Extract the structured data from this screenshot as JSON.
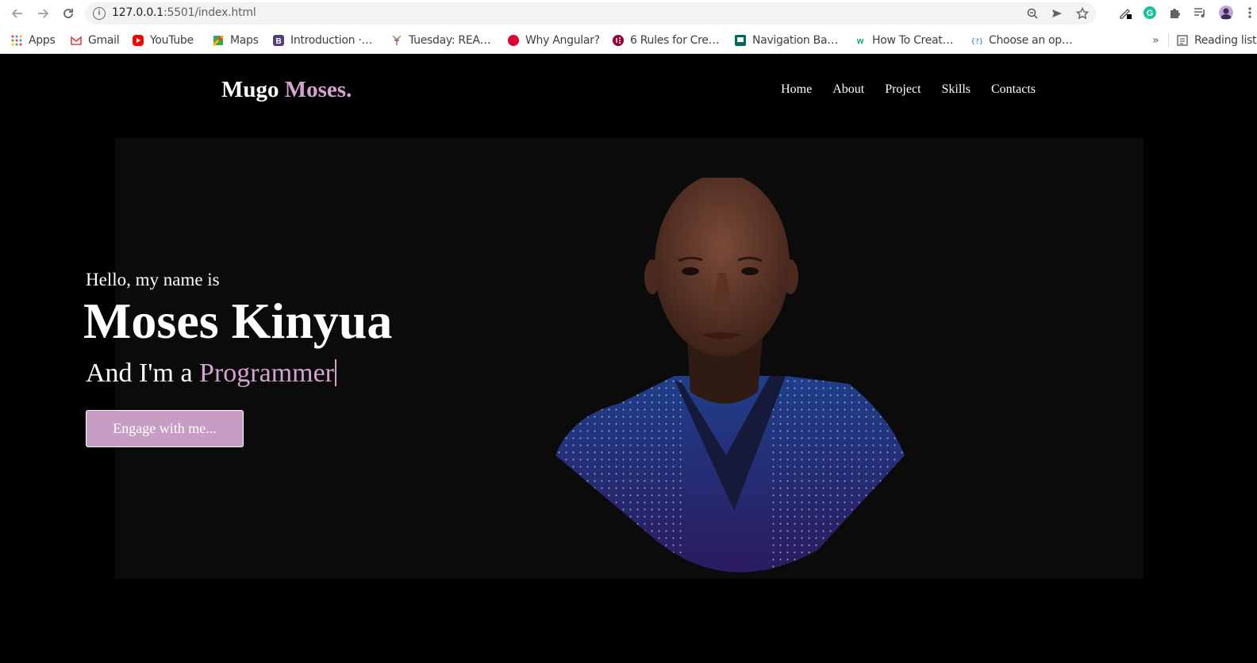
{
  "browser": {
    "url_host": "127.0.0.1",
    "url_rest": ":5501/index.html",
    "bookmarks": [
      {
        "label": "Apps",
        "color": "#4285f4"
      },
      {
        "label": "Gmail",
        "color": "#ea4335"
      },
      {
        "label": "YouTube",
        "color": "#ff0000"
      },
      {
        "label": "Maps",
        "color": "#34a853"
      },
      {
        "label": "Introduction ·…",
        "color": "#563d7c"
      },
      {
        "label": "Tuesday: REA…",
        "color": "#8d6e63"
      },
      {
        "label": "Why Angular?",
        "color": "#dd0031"
      },
      {
        "label": "6 Rules for Cre…",
        "color": "#92003b"
      },
      {
        "label": "Navigation Ba…",
        "color": "#00695c"
      },
      {
        "label": "How To Creat…",
        "color": "#04aa6d"
      },
      {
        "label": "Choose an op…",
        "color": "#1a73e8"
      }
    ],
    "reading_list": "Reading list",
    "more": "»"
  },
  "site": {
    "logo_first": "Mugo",
    "logo_second": "Moses.",
    "nav": [
      "Home",
      "About",
      "Project",
      "Skills",
      "Contacts"
    ]
  },
  "hero": {
    "greeting": "Hello, my name is",
    "name": "Moses Kinyua",
    "role_prefix": "And I'm a",
    "role_highlight": "Programmer",
    "cta": "Engage with me..."
  },
  "colors": {
    "accent": "#d4a4cf",
    "button": "#c79dc4",
    "hero_bg": "#0b0b0b",
    "page_bg": "#000000"
  }
}
